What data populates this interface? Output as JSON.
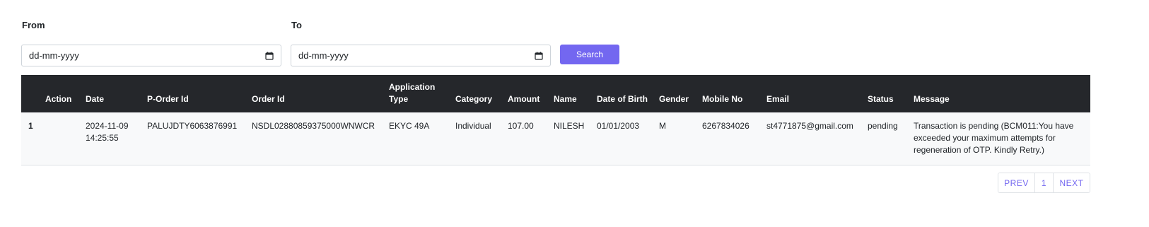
{
  "filters": {
    "from_label": "From",
    "to_label": "To",
    "from_placeholder": "dd-mm-yyyy",
    "to_placeholder": "dd-mm-yyyy",
    "search_label": "Search"
  },
  "table": {
    "headers": [
      "Action",
      "Date",
      "P-Order Id",
      "Order Id",
      "Application Type",
      "Category",
      "Amount",
      "Name",
      "Date of Birth",
      "Gender",
      "Mobile No",
      "Email",
      "Status",
      "Message"
    ],
    "rows": [
      {
        "action": "1",
        "date": "2024-11-09 14:25:55",
        "p_order_id": "PALUJDTY6063876991",
        "order_id": "NSDL02880859375000WNWCR",
        "application_type": "EKYC 49A",
        "category": "Individual",
        "amount": "107.00",
        "name": "NILESH",
        "dob": "01/01/2003",
        "gender": "M",
        "mobile": "6267834026",
        "email": "st4771875@gmail.com",
        "status": "pending",
        "message": "Transaction is pending (BCM011:You have exceeded your maximum attempts for regeneration of OTP. Kindly Retry.)"
      }
    ]
  },
  "pagination": {
    "prev_label": "PREV",
    "current_page": "1",
    "next_label": "NEXT"
  },
  "colors": {
    "accent": "#7367f0",
    "header_bg": "#25272b",
    "row_bg": "#f8f9fa"
  },
  "icons": {
    "date_picker": "calendar-icon"
  }
}
